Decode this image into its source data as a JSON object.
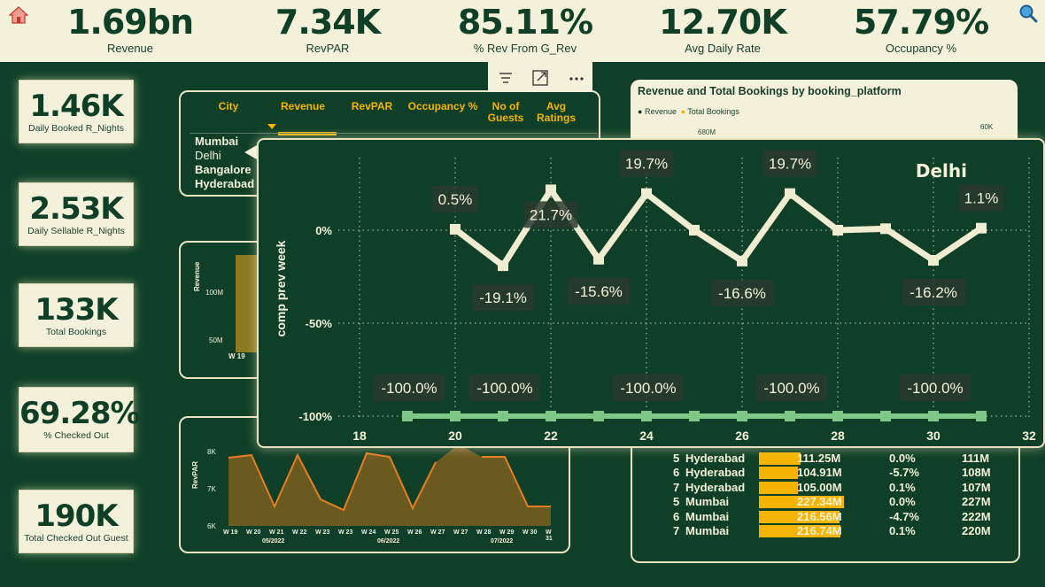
{
  "kpis": [
    {
      "value": "1.69bn",
      "label": "Revenue"
    },
    {
      "value": "7.34K",
      "label": "RevPAR"
    },
    {
      "value": "85.11%",
      "label": "% Rev From G_Rev"
    },
    {
      "value": "12.70K",
      "label": "Avg Daily Rate"
    },
    {
      "value": "57.79%",
      "label": "Occupancy %"
    }
  ],
  "cards": [
    {
      "value": "1.46K",
      "label": "Daily Booked R_Nights"
    },
    {
      "value": "2.53K",
      "label": "Daily Sellable R_Nights"
    },
    {
      "value": "133K",
      "label": "Total Bookings"
    },
    {
      "value": "69.28%",
      "label": "% Checked Out"
    },
    {
      "value": "190K",
      "label": "Total Checked Out Guest"
    }
  ],
  "city_table": {
    "headers": [
      "City",
      "Revenue",
      "RevPAR",
      "Occupancy %",
      "No of Guests",
      "Avg Ratings"
    ],
    "cities": [
      "Mumbai",
      "Delhi",
      "Bangalore",
      "Hyderabad"
    ]
  },
  "platform": {
    "title": "Revenue and Total Bookings by booking_platform",
    "legend": [
      "Revenue",
      "Total Bookings"
    ],
    "left_tick": "680M",
    "right_tick": "60K"
  },
  "bg_chart_mid": {
    "ylabel": "Revenue",
    "ticks": [
      "100M",
      "50M"
    ],
    "x_first": "W 19"
  },
  "bg_chart_bottom": {
    "ylabel": "RevPAR",
    "ticks": [
      "8K",
      "7K",
      "6K"
    ],
    "weeks": [
      "W 19",
      "W 20",
      "W 21",
      "W 22",
      "W 23",
      "W 23",
      "W 24",
      "W 25",
      "W 26",
      "W 27",
      "W 27",
      "W 28",
      "W 29",
      "W 30",
      "W 31"
    ],
    "months": [
      "05/2022",
      "06/2022",
      "07/2022"
    ]
  },
  "bottom_table": [
    {
      "week": "5",
      "city": "Hyderabad",
      "revenue": "111.25M",
      "pct": "0.0%",
      "prev": "111M"
    },
    {
      "week": "6",
      "city": "Hyderabad",
      "revenue": "104.91M",
      "pct": "-5.7%",
      "prev": "108M"
    },
    {
      "week": "7",
      "city": "Hyderabad",
      "revenue": "105.00M",
      "pct": "0.1%",
      "prev": "107M"
    },
    {
      "week": "5",
      "city": "Mumbai",
      "revenue": "227.34M",
      "pct": "0.0%",
      "prev": "227M"
    },
    {
      "week": "6",
      "city": "Mumbai",
      "revenue": "216.56M",
      "pct": "-4.7%",
      "prev": "222M"
    },
    {
      "week": "7",
      "city": "Mumbai",
      "revenue": "216.74M",
      "pct": "0.1%",
      "prev": "220M"
    }
  ],
  "chart_data": {
    "type": "line",
    "title": "Delhi",
    "ylabel": "comp prev week",
    "xlim": [
      18,
      32
    ],
    "x_ticks": [
      18,
      20,
      22,
      24,
      26,
      28,
      30,
      32
    ],
    "y_ticks": [
      "0%",
      "-50%",
      "-100%"
    ],
    "ylim": [
      -100,
      30
    ],
    "series": [
      {
        "x": [
          20,
          21,
          22,
          23,
          24,
          25,
          26,
          27,
          28,
          29,
          30,
          31
        ],
        "values": [
          0.5,
          -19.1,
          21.7,
          -15.6,
          19.7,
          0,
          -16.6,
          19.7,
          0,
          0.8,
          -16.2,
          1.1
        ],
        "labels": [
          "0.5%",
          "-19.1%",
          "21.7%",
          "-15.6%",
          "19.7%",
          "",
          "-16.6%",
          "19.7%",
          "",
          "",
          "-16.2%",
          "1.1%"
        ]
      },
      {
        "x": [
          19,
          20,
          21,
          22,
          23,
          24,
          25,
          26,
          27,
          28,
          29,
          30,
          31
        ],
        "values": [
          -100,
          -100,
          -100,
          -100,
          -100,
          -100,
          -100,
          -100,
          -100,
          -100,
          -100,
          -100,
          -100
        ],
        "labels": [
          "",
          "-100.0%",
          "",
          "-100.0%",
          "",
          "",
          "-100.0%",
          "",
          "",
          "-100.0%",
          "",
          "",
          "-100.0%"
        ]
      }
    ]
  }
}
